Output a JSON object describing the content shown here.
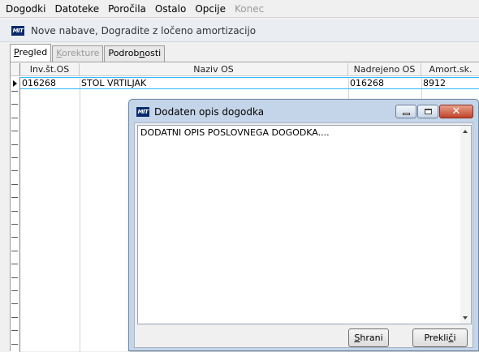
{
  "menu": {
    "items": [
      {
        "label": "Dogodki",
        "disabled": false
      },
      {
        "label": "Datoteke",
        "disabled": false
      },
      {
        "label": "Poročila",
        "disabled": false
      },
      {
        "label": "Ostalo",
        "disabled": false
      },
      {
        "label": "Opcije",
        "disabled": false
      },
      {
        "label": "Konec",
        "disabled": true
      }
    ]
  },
  "window": {
    "logo": "MIT",
    "title": "Nove nabave, Dogradite z ločeno amortizacijo"
  },
  "tabs": [
    {
      "pre": "",
      "ul": "P",
      "post": "regled",
      "active": true,
      "disabled": false
    },
    {
      "pre": "",
      "ul": "K",
      "post": "orekture",
      "active": false,
      "disabled": true
    },
    {
      "pre": "Podrob",
      "ul": "n",
      "post": "osti",
      "active": false,
      "disabled": false
    }
  ],
  "grid": {
    "columns": [
      "Inv.št.OS",
      "Naziv OS",
      "Nadrejeno OS",
      "Amort.sk."
    ],
    "rows": [
      {
        "inv": "016268",
        "naziv": "STOL VRTILJAK",
        "nadrejeno": "016268",
        "amort": "8912"
      }
    ]
  },
  "dialog": {
    "logo": "MIT",
    "title": "Dodaten opis dogodka",
    "memo_text": "DODATNI OPIS POSLOVNEGA DOGODKA....",
    "close_glyph": "✕",
    "save": {
      "ul": "S",
      "post": "hrani"
    },
    "cancel": {
      "pre": "Prekli",
      "ul": "č",
      "post": "i"
    }
  },
  "colors": {
    "selection_border": "#34b8ff",
    "dialog_frame": "#c5d5e9",
    "close_button": "#c0432a"
  },
  "icons": [
    "mit-logo-icon",
    "minimize-icon",
    "maximize-icon",
    "close-icon",
    "scroll-up-icon",
    "scroll-down-icon",
    "row-pointer-icon"
  ]
}
